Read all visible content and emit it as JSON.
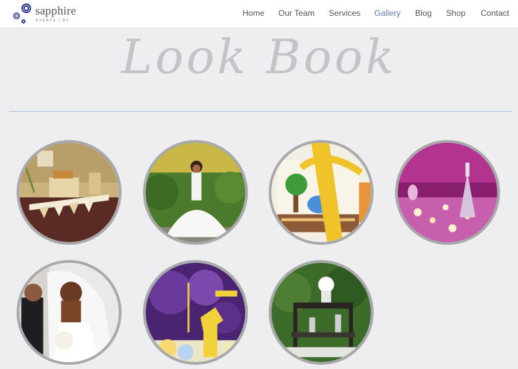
{
  "brand": {
    "name": "sapphire",
    "tagline": "EVENTS | DC",
    "accent": "#2f3a8f"
  },
  "nav": {
    "items": [
      {
        "label": "Home"
      },
      {
        "label": "Our Team"
      },
      {
        "label": "Services"
      },
      {
        "label": "Gallery",
        "active": true
      },
      {
        "label": "Blog"
      },
      {
        "label": "Shop"
      },
      {
        "label": "Contact"
      }
    ],
    "active_color": "#5d7bb0"
  },
  "page": {
    "title": "Look Book"
  },
  "gallery": {
    "items": [
      {
        "subject": "dessert-table-photo"
      },
      {
        "subject": "bride-in-garden-photo"
      },
      {
        "subject": "invitation-with-ribbon-photo"
      },
      {
        "subject": "candlelit-table-photo"
      },
      {
        "subject": "bride-with-veil-photo"
      },
      {
        "subject": "purple-pompom-party-photo"
      },
      {
        "subject": "outdoor-buffet-photo"
      }
    ]
  }
}
